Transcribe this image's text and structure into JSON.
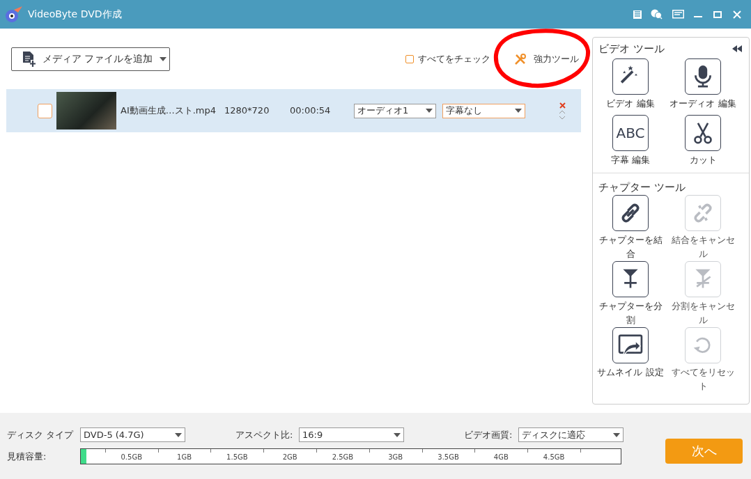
{
  "window": {
    "title": "VideoByte DVD作成"
  },
  "toolbar": {
    "add_media": "メディア ファイルを追加",
    "check_all": {
      "label": "すべてをチェック",
      "checked": false
    },
    "power_tools": "強力ツール"
  },
  "files": [
    {
      "name": "AI動画生成…スト.mp4",
      "resolution": "1280*720",
      "duration": "00:00:54",
      "audio": "オーディオ1",
      "subtitle": "字幕なし",
      "checked": false
    }
  ],
  "video_tools": {
    "title": "ビデオ ツール",
    "items": [
      {
        "kind": "wand",
        "label": "ビデオ 編集",
        "disabled": false
      },
      {
        "kind": "mic",
        "label": "オーディオ 編集",
        "disabled": false
      },
      {
        "kind": "abc",
        "label": "字幕 編集",
        "icon_text": "ABC",
        "disabled": false
      },
      {
        "kind": "scissors",
        "label": "カット",
        "disabled": false
      }
    ]
  },
  "chapter_tools": {
    "title": "チャプター ツール",
    "items": [
      {
        "kind": "link",
        "label": "チャプターを結合",
        "disabled": false
      },
      {
        "kind": "unlink",
        "label": "結合をキャンセル",
        "disabled": true
      },
      {
        "kind": "split",
        "label": "チャプターを分割",
        "disabled": false
      },
      {
        "kind": "unsplit",
        "label": "分割をキャンセル",
        "disabled": true
      },
      {
        "kind": "thumb",
        "label": "サムネイル 設定",
        "disabled": false
      },
      {
        "kind": "reset",
        "label": "すべてをリセット",
        "disabled": true
      }
    ]
  },
  "settings": {
    "disc_type_label": "ディスク タイプ",
    "disc_type": "DVD-5 (4.7G)",
    "aspect_label": "アスペクト比:",
    "aspect": "16:9",
    "quality_label": "ビデオ画質:",
    "quality": "ディスクに適応"
  },
  "capacity": {
    "label": "見積容量:",
    "level": 0.01,
    "ticks": [
      "0.5GB",
      "1GB",
      "1.5GB",
      "2GB",
      "2.5GB",
      "3GB",
      "3.5GB",
      "4GB",
      "4.5GB"
    ]
  },
  "next_button": "次へ"
}
